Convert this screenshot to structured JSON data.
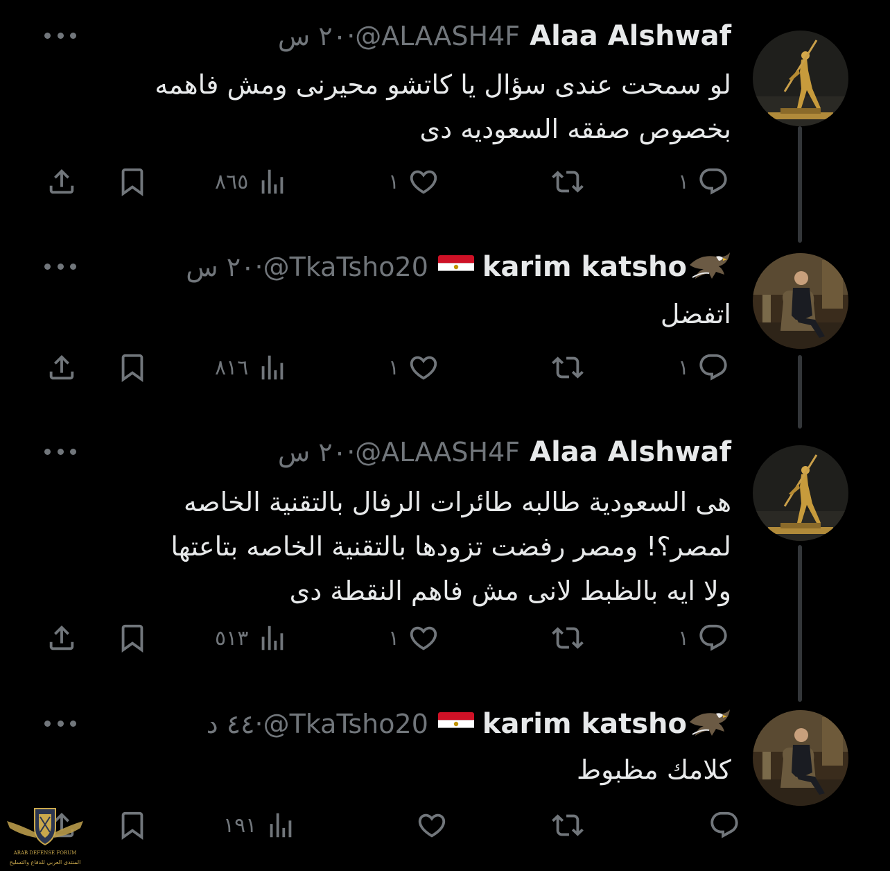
{
  "tweets": [
    {
      "name": "Alaa Alshwaf",
      "handle": "@ALAASH4F",
      "time": "٢٠ س",
      "has_flag": false,
      "has_eagle": false,
      "text_lines": [
        "لو سمحت عندى سؤال يا كاتشو محيرنى ومش فاهمه",
        "بخصوص صفقه السعوديه دى"
      ],
      "reply_count": "١",
      "repost_count": "",
      "like_count": "١",
      "views": "٨٦٥"
    },
    {
      "name": "karim katsho",
      "handle": "@TkaTsho20",
      "time": "٢٠ س",
      "has_flag": true,
      "has_eagle": true,
      "text_lines": [
        "اتفضل"
      ],
      "reply_count": "١",
      "repost_count": "",
      "like_count": "١",
      "views": "٨١٦"
    },
    {
      "name": "Alaa Alshwaf",
      "handle": "@ALAASH4F",
      "time": "٢٠ س",
      "has_flag": false,
      "has_eagle": false,
      "text_lines": [
        "هى السعودية طالبه طائرات الرفال بالتقنية الخاصه",
        "لمصر؟! ومصر رفضت تزودها بالتقنية الخاصه بتاعتها",
        "ولا ايه بالظبط لانى مش فاهم النقطة دى"
      ],
      "reply_count": "١",
      "repost_count": "",
      "like_count": "١",
      "views": "٥١٣"
    },
    {
      "name": "karim katsho",
      "handle": "@TkaTsho20",
      "time": "٤٤ د",
      "has_flag": true,
      "has_eagle": true,
      "text_lines": [
        "كلامك مظبوط"
      ],
      "reply_count": "",
      "repost_count": "",
      "like_count": "",
      "views": "١٩١"
    }
  ],
  "separator": "·",
  "icons": {
    "reply": "reply-icon",
    "repost": "repost-icon",
    "like": "heart-icon",
    "views": "views-icon",
    "bookmark": "bookmark-icon",
    "share": "share-icon",
    "more": "more-icon"
  },
  "watermark": {
    "text_en": "ARAB DEFENSE FORUM",
    "text_ar": "المنتدى العربي للدفاع والتسليح"
  },
  "colors": {
    "background": "#000000",
    "text": "#e7e9ea",
    "secondary": "#71767b",
    "thread_line": "#333639"
  }
}
